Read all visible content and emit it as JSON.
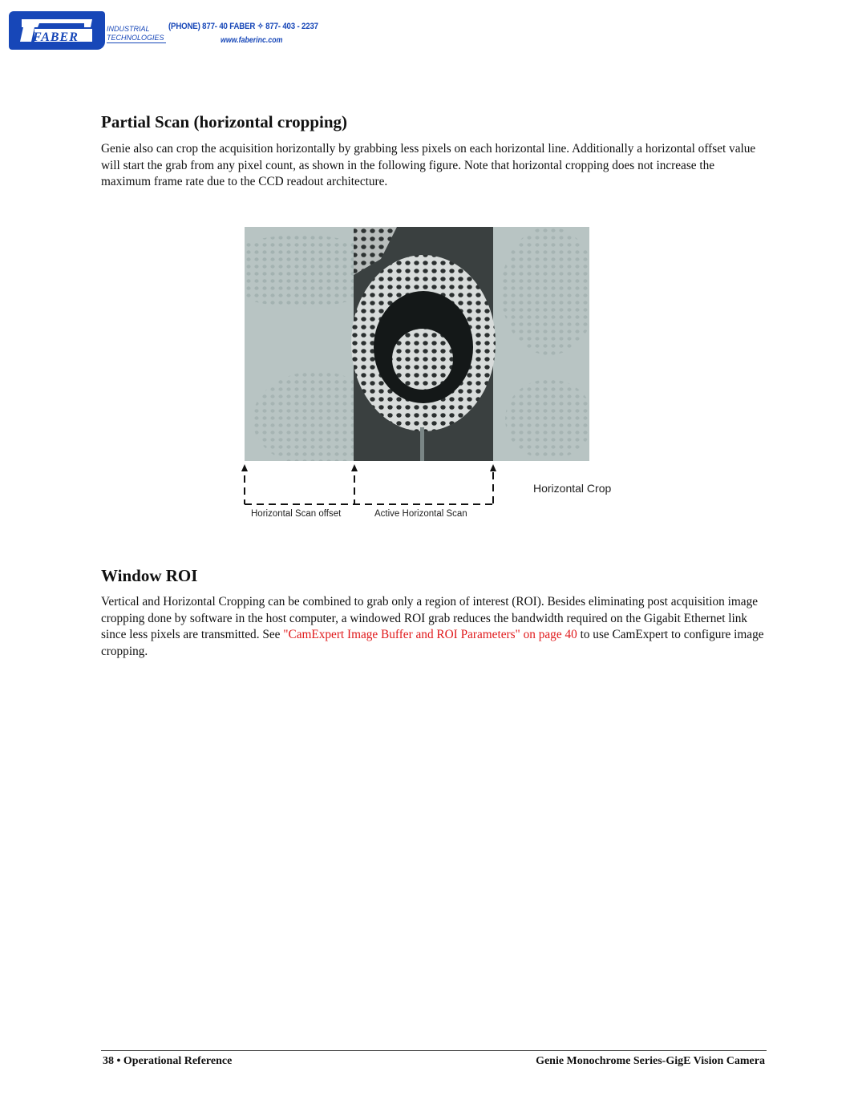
{
  "header": {
    "logo_text": "FABER",
    "logo_sub_line1": "INDUSTRIAL",
    "logo_sub_line2": "TECHNOLOGIES",
    "contact": "(PHONE) 877- 40 FABER ✧ 877- 403 - 2237",
    "website": "www.faberinc.com",
    "brand_color": "#1747b8"
  },
  "section1": {
    "heading": "Partial Scan (horizontal cropping)",
    "body": "Genie also can crop the acquisition horizontally by grabbing less pixels on each horizontal line. Additionally a horizontal offset value will start the grab from any pixel count, as shown in the following figure. Note that horizontal cropping does not increase the maximum frame rate due to the CCD readout architecture."
  },
  "figure": {
    "description": "Microscope image of radiolarian with active horizontal scan region highlighted",
    "label_crop": "Horizontal Crop",
    "label_offset": "Horizontal Scan offset",
    "label_active": "Active Horizontal Scan"
  },
  "section2": {
    "heading": "Window ROI",
    "body_before": "Vertical and Horizontal Cropping can be combined to grab only a region of interest (ROI). Besides eliminating post acquisition image cropping done by software in the host computer, a windowed ROI grab reduces the bandwidth required on the Gigabit Ethernet link since less pixels are transmitted. See ",
    "link_text": "\"CamExpert Image Buffer and ROI Parameters\"",
    "link_page": " on page 40",
    "body_after": " to use CamExpert to configure image cropping.",
    "link_color": "#e0191b"
  },
  "footer": {
    "page_number": "38",
    "section": "Operational Reference",
    "left": "38 • Operational Reference",
    "right": "Genie Monochrome Series-GigE Vision Camera"
  }
}
